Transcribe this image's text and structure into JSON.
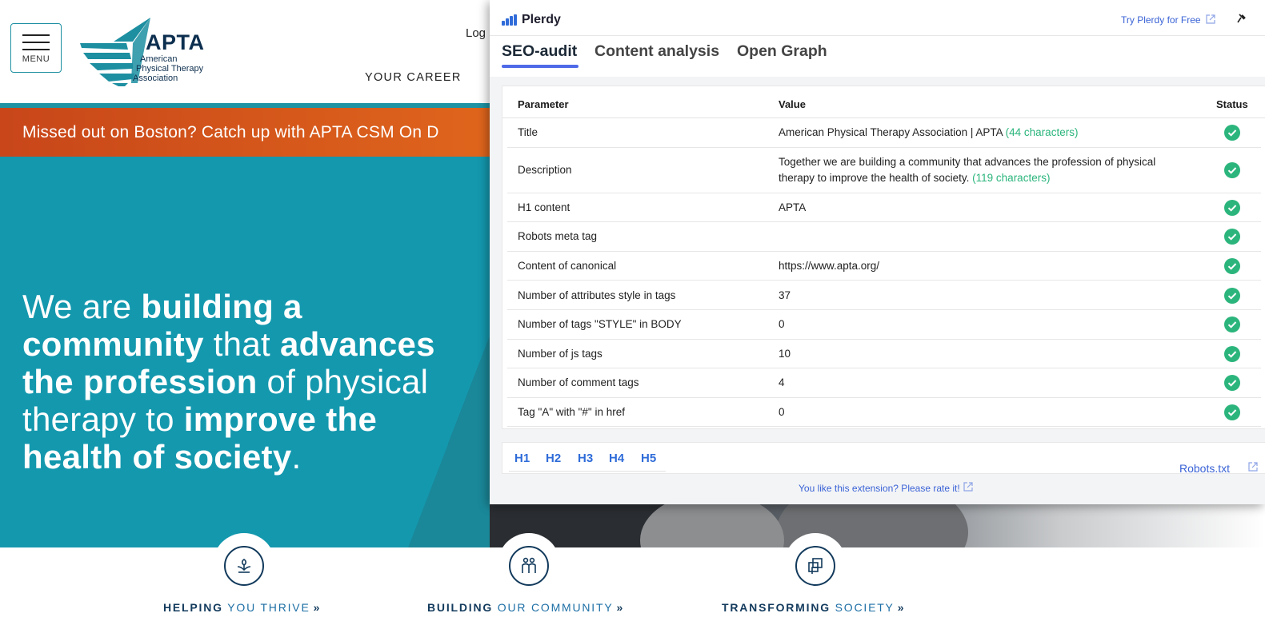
{
  "header": {
    "menu_label": "MENU",
    "logo_text": "APTA",
    "logo_sub": [
      "American",
      "Physical Therapy",
      "Association"
    ],
    "login": "Log",
    "your_career": "YOUR CAREER"
  },
  "banner": {
    "text": "Missed out on Boston? Catch up with APTA CSM On D"
  },
  "hero": {
    "parts": [
      {
        "t": "We are ",
        "b": false
      },
      {
        "t": "building a community",
        "b": true
      },
      {
        "t": " that ",
        "b": false
      },
      {
        "t": "advances the profession",
        "b": true
      },
      {
        "t": " of physical therapy to ",
        "b": false
      },
      {
        "t": "improve the health of society",
        "b": true
      },
      {
        "t": ".",
        "b": false
      }
    ]
  },
  "pillars": [
    {
      "bold": "HELPING",
      "light": "YOU THRIVE",
      "chevron": "»",
      "icon": "plant-hands-icon"
    },
    {
      "bold": "BUILDING",
      "light": "OUR COMMUNITY",
      "chevron": "»",
      "icon": "people-icon"
    },
    {
      "bold": "TRANSFORMING",
      "light": "SOCIETY",
      "chevron": "»",
      "icon": "squares-icon"
    }
  ],
  "plerdy": {
    "brand": "Plerdy",
    "try_free": "Try Plerdy for Free",
    "pin": "📌",
    "tabs": [
      "SEO-audit",
      "Content analysis",
      "Open Graph"
    ],
    "active_tab": "SEO-audit",
    "columns": {
      "parameter": "Parameter",
      "value": "Value",
      "status": "Status"
    },
    "rows": [
      {
        "parameter": "Title",
        "value": "American Physical Therapy Association | APTA",
        "chars": "(44 characters)",
        "status": "ok"
      },
      {
        "parameter": "Description",
        "value": "Together we are building a community that advances the profession of physical therapy to improve the health of society.",
        "chars": "(119 characters)",
        "status": "ok"
      },
      {
        "parameter": "H1 content",
        "value": "APTA",
        "chars": "",
        "status": "ok"
      },
      {
        "parameter": "Robots meta tag",
        "value": "",
        "chars": "",
        "status": "ok"
      },
      {
        "parameter": "Content of canonical",
        "value": "https://www.apta.org/",
        "chars": "",
        "status": "ok"
      },
      {
        "parameter": "Number of attributes style in tags",
        "value": "37",
        "chars": "",
        "status": "ok"
      },
      {
        "parameter": "Number of tags \"STYLE\" in BODY",
        "value": "0",
        "chars": "",
        "status": "ok"
      },
      {
        "parameter": "Number of js tags",
        "value": "10",
        "chars": "",
        "status": "ok"
      },
      {
        "parameter": "Number of comment tags",
        "value": "4",
        "chars": "",
        "status": "ok"
      },
      {
        "parameter": "Tag \"A\" with \"#\" in href",
        "value": "0",
        "chars": "",
        "status": "ok"
      }
    ],
    "heading_tabs": [
      "H1",
      "H2",
      "H3",
      "H4",
      "H5"
    ],
    "robots_link": "Robots.txt",
    "rate_text": "You like this extension? Please rate it!",
    "status_color": "#2bb57c",
    "accent_color": "#4f6ae8"
  },
  "colors": {
    "teal": "#1498ae",
    "banner_orange": "#e0661c",
    "navy": "#123a5c"
  }
}
